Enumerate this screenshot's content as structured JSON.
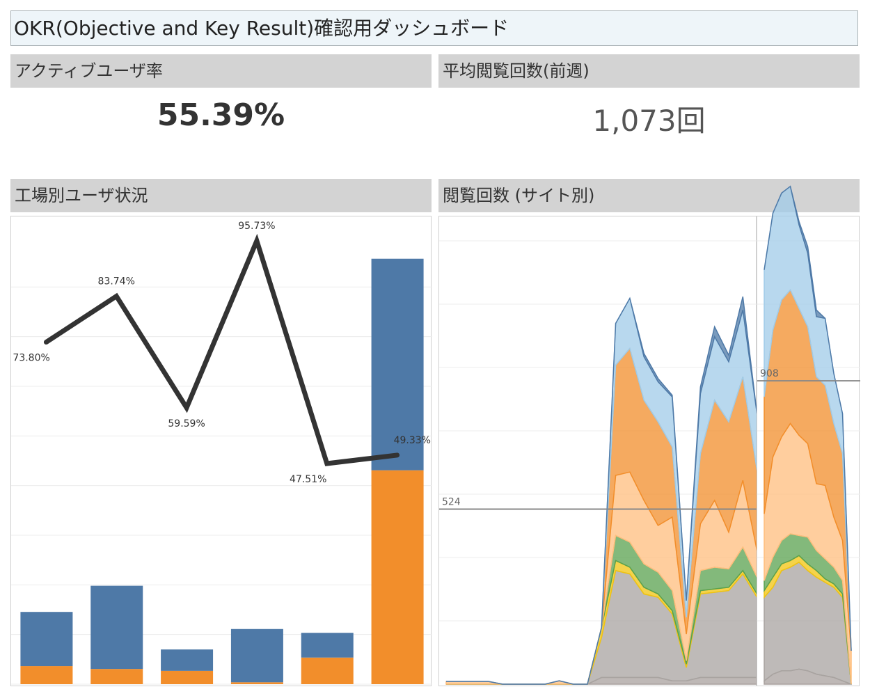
{
  "dashboard": {
    "title": "OKR(Objective and Key Result)確認用ダッシュボード"
  },
  "kpi_active": {
    "header": "アクティブユーザ率",
    "value": "55.39%"
  },
  "kpi_views": {
    "header": "平均閲覧回数(前週)",
    "value": "1,073回"
  },
  "factory_panel": {
    "header": "工場別ユーザ状況"
  },
  "views_panel": {
    "header": "閲覧回数 (サイト別)"
  },
  "colors": {
    "blue": "#4e79a7",
    "orange": "#f28e2b",
    "line": "#333333",
    "light_blue": "#a0cbe8",
    "light_orange": "#ffbe7d",
    "green": "#59a14f",
    "gray": "#8a8280"
  },
  "chart_data": [
    {
      "type": "bar",
      "title": "工場別ユーザ状況",
      "xlabel": "",
      "ylabel": "",
      "categories": [
        "",
        "",
        "",
        "",
        "",
        ""
      ],
      "grid": true,
      "series": [
        {
          "color": "#f28e2b",
          "values": [
            38,
            32,
            28,
            4,
            56,
            450
          ]
        },
        {
          "color": "#4e79a7",
          "values": [
            114,
            175,
            45,
            112,
            52,
            445
          ]
        }
      ],
      "line": {
        "color": "#333333",
        "values": [
          73.8,
          83.74,
          59.59,
          95.73,
          47.51,
          49.33
        ],
        "labels": [
          "73.80%",
          "83.74%",
          "59.59%",
          "95.73%",
          "47.51%",
          "49.33%"
        ],
        "ylim": [
          0,
          100
        ]
      },
      "ylim": [
        0,
        940
      ]
    },
    {
      "type": "area",
      "title": "閲覧回数 (サイト別)",
      "xlabel": "",
      "ylabel": "",
      "grid": true,
      "ylim": [
        0,
        1400
      ],
      "panes": [
        {
          "x": [
            0,
            1,
            2,
            3,
            4,
            5,
            6,
            7,
            8,
            9,
            10,
            11,
            12,
            13,
            14,
            15,
            16,
            17,
            18,
            19,
            20,
            21,
            22
          ],
          "series": [
            {
              "color": "#a8a09d",
              "values": [
                0,
                0,
                0,
                0,
                0,
                0,
                0,
                0,
                0,
                0,
                0,
                20,
                20,
                20,
                20,
                20,
                10,
                10,
                20,
                20,
                20,
                20,
                20
              ]
            },
            {
              "color": "#a8a3a0",
              "values": [
                0,
                0,
                0,
                0,
                0,
                0,
                0,
                0,
                0,
                0,
                0,
                120,
                320,
                310,
                250,
                240,
                200,
                40,
                250,
                255,
                260,
                310,
                240
              ]
            },
            {
              "color": "#f1c40f",
              "values": [
                0,
                0,
                0,
                0,
                0,
                0,
                0,
                0,
                0,
                0,
                0,
                30,
                30,
                20,
                20,
                10,
                10,
                10,
                10,
                10,
                10,
                10,
                10
              ]
            },
            {
              "color": "#59a14f",
              "values": [
                0,
                0,
                0,
                0,
                0,
                0,
                0,
                0,
                0,
                0,
                0,
                0,
                75,
                75,
                70,
                65,
                60,
                10,
                60,
                65,
                55,
                70,
                50
              ]
            },
            {
              "color": "#ffbe7d",
              "values": [
                8,
                8,
                8,
                8,
                0,
                0,
                0,
                0,
                10,
                0,
                0,
                0,
                180,
                210,
                190,
                140,
                220,
                80,
                140,
                200,
                110,
                200,
                80
              ]
            },
            {
              "color": "#f28e2b",
              "values": [
                0,
                0,
                0,
                0,
                0,
                0,
                0,
                0,
                0,
                0,
                0,
                0,
                330,
                370,
                300,
                310,
                210,
                50,
                210,
                300,
                330,
                310,
                240
              ]
            },
            {
              "color": "#a0cbe8",
              "values": [
                0,
                0,
                0,
                0,
                0,
                0,
                0,
                0,
                0,
                0,
                0,
                0,
                125,
                150,
                130,
                120,
                150,
                50,
                180,
                190,
                180,
                200,
                170
              ]
            },
            {
              "color": "#4e79a7",
              "values": [
                0,
                0,
                0,
                0,
                0,
                0,
                0,
                0,
                0,
                0,
                0,
                0,
                0,
                0,
                10,
                10,
                5,
                0,
                20,
                30,
                20,
                40,
                0
              ]
            }
          ],
          "reference_line": {
            "value": 524,
            "label": "524"
          }
        },
        {
          "x": [
            0,
            1,
            2,
            3,
            4,
            5,
            6,
            7,
            8,
            9,
            10
          ],
          "series": [
            {
              "color": "#a8a09d",
              "values": [
                10,
                30,
                40,
                40,
                45,
                40,
                30,
                25,
                20,
                10,
                0
              ]
            },
            {
              "color": "#a8a3a0",
              "values": [
                250,
                260,
                300,
                310,
                320,
                300,
                290,
                280,
                270,
                250,
                0
              ]
            },
            {
              "color": "#f1c40f",
              "values": [
                20,
                30,
                20,
                20,
                20,
                20,
                20,
                10,
                10,
                10,
                0
              ]
            },
            {
              "color": "#59a14f",
              "values": [
                30,
                60,
                70,
                80,
                60,
                80,
                60,
                60,
                50,
                40,
                0
              ]
            },
            {
              "color": "#ffbe7d",
              "values": [
                200,
                300,
                310,
                330,
                300,
                280,
                200,
                220,
                150,
                120,
                100
              ]
            },
            {
              "color": "#f28e2b",
              "values": [
                350,
                380,
                410,
                400,
                380,
                350,
                320,
                300,
                280,
                260,
                0
              ]
            },
            {
              "color": "#a0cbe8",
              "values": [
                380,
                350,
                320,
                310,
                250,
                220,
                180,
                200,
                150,
                120,
                0
              ]
            },
            {
              "color": "#4e79a7",
              "values": [
                0,
                0,
                0,
                0,
                10,
                20,
                20,
                0,
                0,
                0,
                0
              ]
            }
          ],
          "reference_line": {
            "value": 908,
            "label": "908"
          }
        }
      ]
    }
  ]
}
